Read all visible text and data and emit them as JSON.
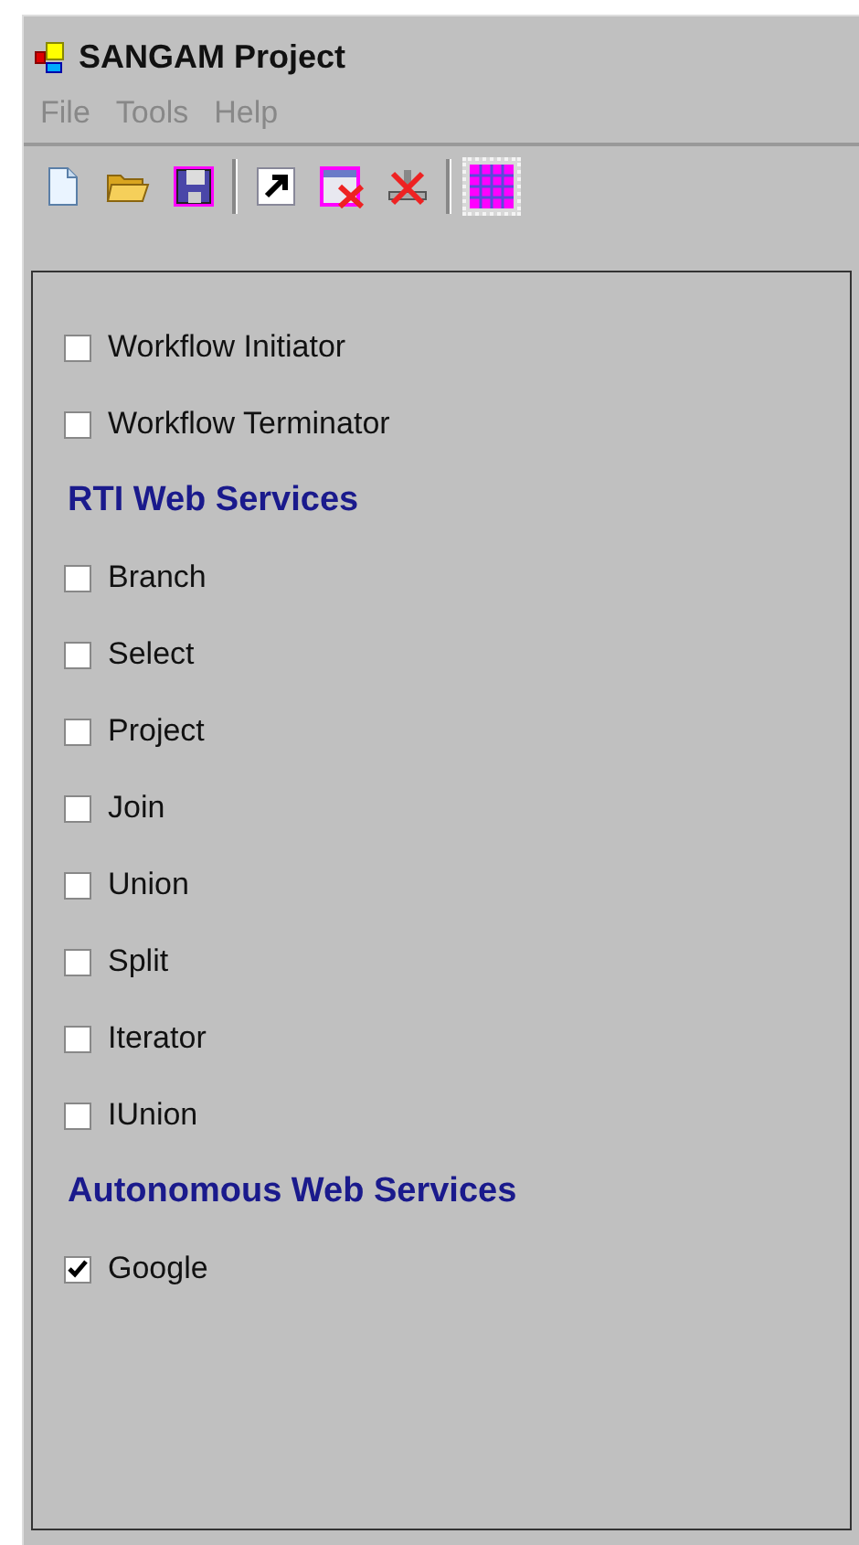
{
  "window": {
    "title": "SANGAM Project"
  },
  "menu": [
    {
      "label": "File",
      "disabled": true
    },
    {
      "label": "Tools",
      "disabled": true
    },
    {
      "label": "Help",
      "disabled": true
    }
  ],
  "toolbar": [
    [
      {
        "kind": "new",
        "pressed": false
      },
      {
        "kind": "open",
        "pressed": false
      },
      {
        "kind": "save",
        "pressed": false
      }
    ],
    [
      {
        "kind": "arrow",
        "pressed": false
      },
      {
        "kind": "close-window",
        "pressed": false
      },
      {
        "kind": "delete",
        "pressed": false
      }
    ],
    [
      {
        "kind": "grid",
        "pressed": true
      }
    ]
  ],
  "items": [
    {
      "kind": "checkbox",
      "label": "Workflow Initiator",
      "checked": false
    },
    {
      "kind": "checkbox",
      "label": "Workflow Terminator",
      "checked": false
    },
    {
      "kind": "header",
      "label": "RTI Web Services"
    },
    {
      "kind": "checkbox",
      "label": "Branch",
      "checked": false
    },
    {
      "kind": "checkbox",
      "label": "Select",
      "checked": false
    },
    {
      "kind": "checkbox",
      "label": "Project",
      "checked": false
    },
    {
      "kind": "checkbox",
      "label": "Join",
      "checked": false
    },
    {
      "kind": "checkbox",
      "label": "Union",
      "checked": false
    },
    {
      "kind": "checkbox",
      "label": "Split",
      "checked": false
    },
    {
      "kind": "checkbox",
      "label": "Iterator",
      "checked": false
    },
    {
      "kind": "checkbox",
      "label": "IUnion",
      "checked": false
    },
    {
      "kind": "header",
      "label": "Autonomous Web Services"
    },
    {
      "kind": "checkbox",
      "label": "Google",
      "checked": true
    }
  ]
}
